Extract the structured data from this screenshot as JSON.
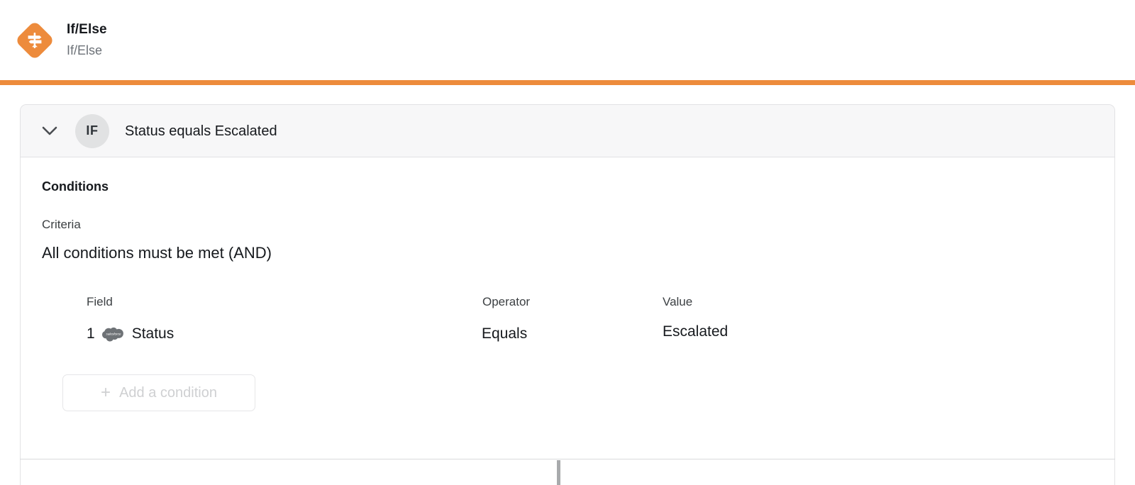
{
  "header": {
    "icon_name": "if-else-signpost-icon",
    "icon_color": "#ED8B3C",
    "title": "If/Else",
    "subtitle": "If/Else"
  },
  "accent_rule_color": "#ED8B3C",
  "branch_card": {
    "collapse_icon": "chevron-down-icon",
    "badge": "IF",
    "summary": "Status equals Escalated",
    "section_title": "Conditions",
    "criteria": {
      "label": "Criteria",
      "value": "All conditions must be met (AND)"
    },
    "table": {
      "columns": [
        "Field",
        "Operator",
        "Value"
      ],
      "rows": [
        {
          "index": "1",
          "source_icon": "salesforce-cloud-icon",
          "field": "Status",
          "operator": "Equals",
          "value": "Escalated"
        }
      ]
    },
    "add_condition": {
      "icon": "plus-icon",
      "label": "Add a condition"
    }
  },
  "footer": {
    "resize_handle": "panel-resize-handle"
  }
}
